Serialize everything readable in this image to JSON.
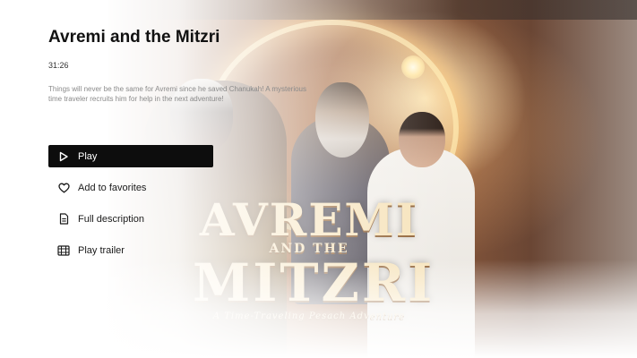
{
  "movie": {
    "title": "Avremi and the Mitzri",
    "duration": "31:26",
    "description": "Things will never be the same for Avremi since he saved Chanukah! A mysterious time traveler recruits him for help in the next adventure!"
  },
  "poster": {
    "line1": "AVREMI",
    "line2": "AND THE",
    "line3": "MITZRI",
    "tagline": "A Time-Traveling Pesach Adventure"
  },
  "menu": {
    "items": [
      {
        "label": "Play",
        "icon": "play-icon",
        "active": true
      },
      {
        "label": "Add to favorites",
        "icon": "heart-icon",
        "active": false
      },
      {
        "label": "Full description",
        "icon": "document-icon",
        "active": false
      },
      {
        "label": "Play trailer",
        "icon": "film-icon",
        "active": false
      }
    ]
  },
  "colors": {
    "active_bg": "#0d0d0d",
    "active_text": "#ffffff",
    "text": "#1a1a1a",
    "muted": "#8a8a8a"
  }
}
